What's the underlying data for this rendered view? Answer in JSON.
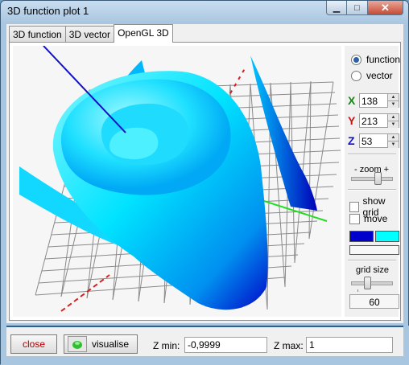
{
  "window": {
    "title": "3D function plot 1"
  },
  "tabs": [
    {
      "label": "3D function"
    },
    {
      "label": "3D vector"
    },
    {
      "label": "OpenGL 3D"
    }
  ],
  "side": {
    "mode_function": "function",
    "mode_vector": "vector",
    "x_label": "X",
    "x_value": "138",
    "y_label": "Y",
    "y_value": "213",
    "z_label": "Z",
    "z_value": "53",
    "zoom_label": "-  zoom  +",
    "show_grid": "show grid",
    "move": "move",
    "color_low": "#0000cc",
    "color_high": "#00ffff",
    "grid_size_label": "grid size",
    "grid_size_value": "60"
  },
  "bottom": {
    "close": "close",
    "visualise": "visualise",
    "zmin_label": "Z min:",
    "zmin_value": "-0,9999",
    "zmax_label": "Z max:",
    "zmax_value": "1"
  }
}
